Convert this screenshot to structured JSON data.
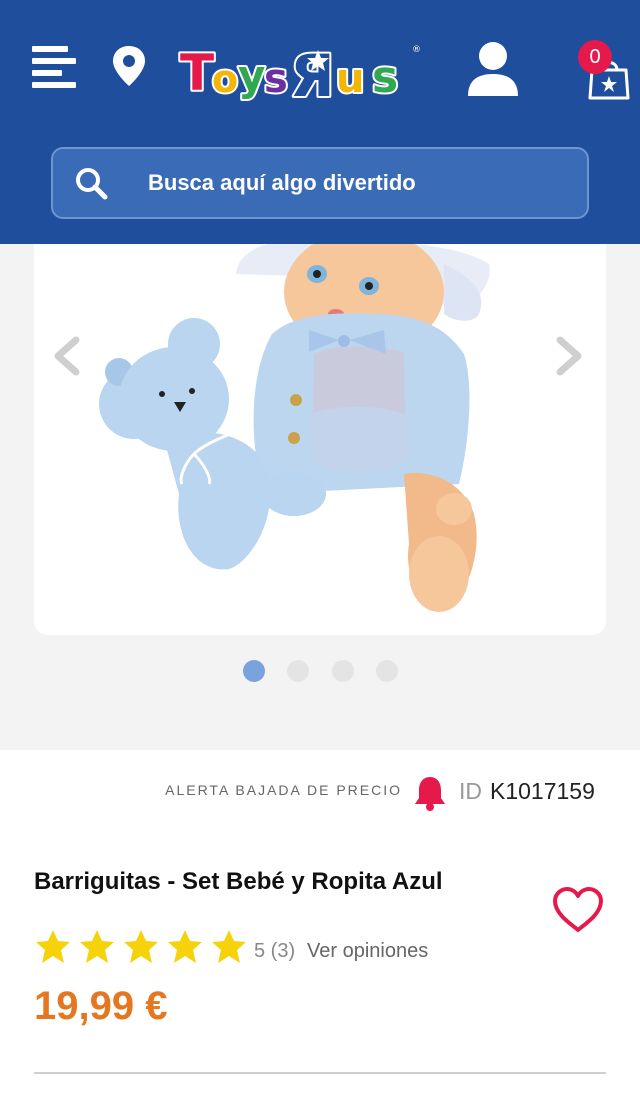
{
  "header": {
    "brand": "ToysRus",
    "brand_colors": [
      "#e6194b",
      "#f2b705",
      "#1f4e9c",
      "#2fa84f",
      "#6b2fa0"
    ],
    "background_color": "#1f4e9c",
    "cart_count": "0",
    "icons": [
      "menu-icon",
      "location-pin-icon",
      "user-icon",
      "shopping-bag-icon"
    ]
  },
  "search": {
    "placeholder": "Busca aquí algo divertido",
    "icon": "search-icon"
  },
  "gallery": {
    "image_subject": "baby doll with knitted teddy bear",
    "slide_count": 4,
    "active_slide": 1,
    "active_dot_color": "#7aa3dd"
  },
  "product": {
    "price_alert_label": "ALERTA BAJADA DE PRECIO",
    "id_prefix": "ID",
    "id_value": "K1017159",
    "title": "Barriguitas - Set Bebé y Ropita Azul",
    "rating_stars": 5,
    "rating_text": "5 (3)",
    "reviews_link": "Ver opiniones",
    "price": "19,99 €",
    "price_color": "#e4771f",
    "star_color": "#f5d20a",
    "accent_color": "#e6194b"
  }
}
